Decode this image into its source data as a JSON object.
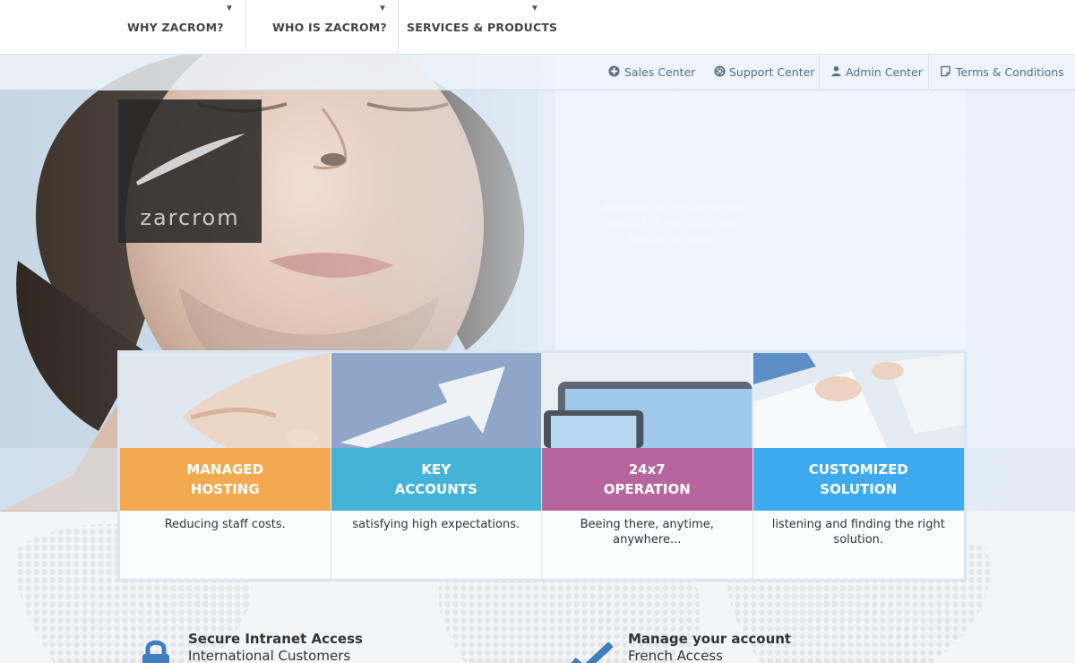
{
  "nav": {
    "items": [
      {
        "label": "WHY ZACROM?"
      },
      {
        "label": "WHO IS ZACROM?"
      },
      {
        "label": "SERVICES & PRODUCTS"
      }
    ]
  },
  "subnav": {
    "links": [
      {
        "label": "Sales Center",
        "icon": "plus-circle-icon"
      },
      {
        "label": "Support Center",
        "icon": "lifebuoy-icon"
      },
      {
        "label": "Admin Center",
        "icon": "user-icon"
      },
      {
        "label": "Terms & Conditions",
        "icon": "document-icon"
      }
    ]
  },
  "hero": {
    "logo_text": "zarcrom",
    "tagline": "Because we are one of the most EXPERIENCED web hosting provider"
  },
  "tiles": [
    {
      "heading": "MANAGED\nHOSTING",
      "description": "Reducing staff costs.",
      "color": "#f2a950"
    },
    {
      "heading": "KEY\nACCOUNTS",
      "description": "satisfying high expectations.",
      "color": "#45b3d8"
    },
    {
      "heading": "24x7\nOPERATION",
      "description": "Beeing there, anytime, anywhere...",
      "color": "#b6659d"
    },
    {
      "heading": "CUSTOMIZED\nSOLUTION",
      "description": "listening and finding the right solution.",
      "color": "#3eaaf0"
    }
  ],
  "access": [
    {
      "title": "Secure Intranet Access",
      "subtitle": "International Customers",
      "icon": "lock-icon"
    },
    {
      "title": "Manage your account",
      "subtitle": "French Access",
      "icon": "checkmark-icon"
    }
  ],
  "colors": {
    "accent_blue": "#5b6e80",
    "icon_blue": "#3c7ec0"
  }
}
